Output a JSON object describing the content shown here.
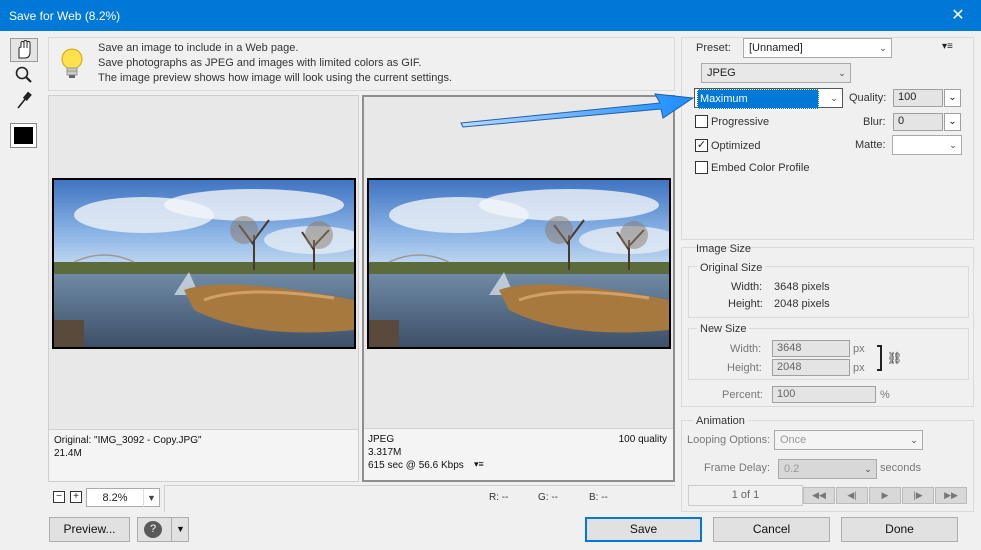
{
  "window": {
    "title": "Save for Web (8.2%)",
    "close_glyph": "✕"
  },
  "toolbar": {
    "tools": [
      "hand-tool-icon",
      "zoom-tool-icon",
      "eyedropper-tool-icon",
      "color-swatch"
    ],
    "swatch_color": "#000000"
  },
  "info": {
    "lines": [
      "Save an image to include in a Web page.",
      "Save photographs as JPEG and images with limited colors as GIF.",
      "The image preview shows how image will look using the current settings."
    ]
  },
  "original_pane": {
    "line1": "Original: \"IMG_3092 - Copy.JPG\"",
    "line2": "21.4M"
  },
  "optimized_pane": {
    "format": "JPEG",
    "quality": "100 quality",
    "size": "3.317M",
    "download": "615 sec @ 56.6 Kbps"
  },
  "zoom": {
    "value": "8.2%",
    "minus": "−",
    "plus": "+"
  },
  "readout": {
    "r": "R: --",
    "g": "G: --",
    "b": "B: --"
  },
  "settings": {
    "preset_label": "Preset:",
    "preset_value": "[Unnamed]",
    "format_value": "JPEG",
    "compression_value": "Maximum",
    "quality_label": "Quality:",
    "quality_value": "100",
    "progressive_label": "Progressive",
    "progressive_checked": false,
    "blur_label": "Blur:",
    "blur_value": "0",
    "optimized_label": "Optimized",
    "optimized_checked": true,
    "matte_label": "Matte:",
    "embed_label": "Embed Color Profile",
    "embed_checked": false
  },
  "image_size": {
    "title": "Image Size",
    "original_title": "Original Size",
    "orig_width_label": "Width:",
    "orig_width_value": "3648 pixels",
    "orig_height_label": "Height:",
    "orig_height_value": "2048 pixels",
    "new_title": "New Size",
    "width_label": "Width:",
    "width_value": "3648",
    "height_label": "Height:",
    "height_value": "2048",
    "unit": "px",
    "percent_label": "Percent:",
    "percent_value": "100",
    "percent_unit": "%"
  },
  "animation": {
    "title": "Animation",
    "looping_label": "Looping Options:",
    "looping_value": "Once",
    "delay_label": "Frame Delay:",
    "delay_value": "0.2",
    "delay_unit": "seconds",
    "frame_counter": "1 of 1"
  },
  "buttons": {
    "preview": "Preview...",
    "save": "Save",
    "cancel": "Cancel",
    "done": "Done"
  },
  "colors": {
    "accent": "#0078d7",
    "arrow": "#1a8cff"
  }
}
